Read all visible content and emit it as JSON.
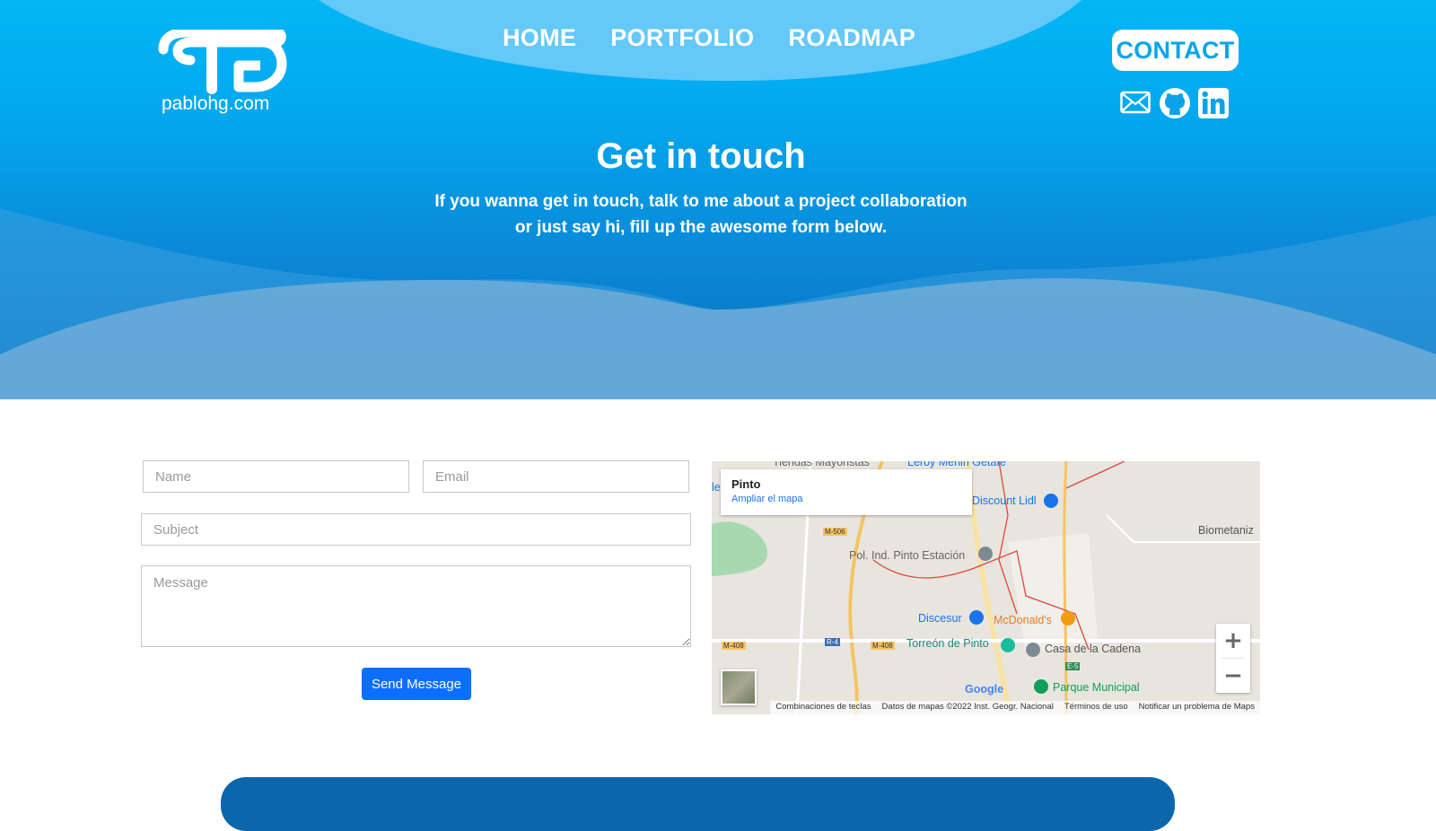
{
  "site": {
    "logo_text": "pablohg.com"
  },
  "nav": {
    "items": [
      "HOME",
      "PORTFOLIO",
      "ROADMAP"
    ]
  },
  "header": {
    "contact_label": "CONTACT",
    "socials": [
      "envelope-icon",
      "github-icon",
      "linkedin-icon"
    ]
  },
  "hero": {
    "title": "Get in touch",
    "subtitle_line1": "If you wanna get in touch, talk to me about a project collaboration",
    "subtitle_line2": "or just say hi, fill up the awesome form below."
  },
  "form": {
    "name_placeholder": "Name",
    "email_placeholder": "Email",
    "subject_placeholder": "Subject",
    "message_placeholder": "Message",
    "send_label": "Send Message"
  },
  "map": {
    "place": "Pinto",
    "enlarge_link": "Ampliar el mapa",
    "labels": {
      "tiendas": "Tiendas Mayoristas",
      "leroy": "Leroy Merlin Getafe",
      "lidl": "Discount Lidl",
      "biometaniz": "Biometaniz",
      "poligono": "Pol. Ind. Pinto Estación",
      "discesur": "Discesur",
      "mcdonalds": "McDonald's",
      "torreon": "Torreón de Pinto",
      "casa": "Casa de la Cadena",
      "parque": "Parque Municipal",
      "google": "Google",
      "m506": "M-506",
      "m408a": "M-408",
      "m408b": "M-408",
      "r4": "R-4",
      "e5": "E-5",
      "edge": "le"
    },
    "zoom_in": "+",
    "zoom_out": "−",
    "footer": [
      "Combinaciones de teclas",
      "Datos de mapas ©2022 Inst. Geogr. Nacional",
      "Términos de uso",
      "Notificar un problema de Maps"
    ]
  },
  "colors": {
    "accent": "#0d6efd",
    "hero_top": "#03b6f5",
    "hero_bottom": "#0b6fb8",
    "footer_card": "#0c66ac"
  }
}
